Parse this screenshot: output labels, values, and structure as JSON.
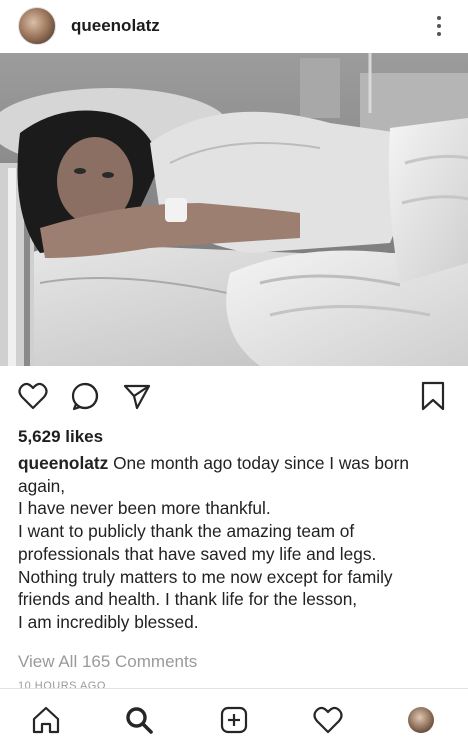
{
  "post": {
    "username": "queenolatz",
    "likes": "5,629 likes",
    "caption_user": "queenolatz",
    "caption_lines": [
      "One month ago today since I was born",
      "again,",
      "I have never been more thankful.",
      "I want to publicly thank the amazing team of",
      "professionals that have saved my life and legs.",
      "Nothing truly matters to me now except for family",
      "friends and health. I thank life for the lesson,",
      "I am incredibly blessed."
    ],
    "comments_link": "View All 165 Comments",
    "timestamp": "10 HOURS AGO"
  },
  "icons": {
    "more": "more-vertical-icon",
    "like": "heart-icon",
    "comment": "comment-icon",
    "share": "send-icon",
    "save": "bookmark-icon",
    "home": "home-icon",
    "search": "search-icon",
    "new_post": "add-post-icon",
    "activity": "heart-icon",
    "profile": "profile-avatar"
  },
  "colors": {
    "text": "#262626",
    "muted": "#9a9a9a",
    "icon": "#262626"
  }
}
